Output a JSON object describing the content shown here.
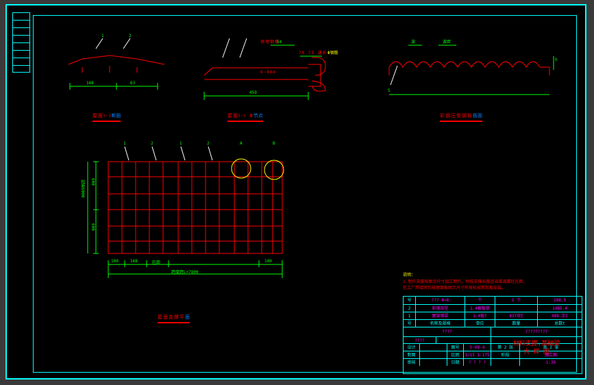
{
  "details": {
    "section_ii": {
      "caption_red": "屋面Ⅰ-Ⅰ",
      "caption_blue": "断面",
      "dim_left": "168",
      "dim_right": "63",
      "lead_1": "1",
      "lead_2": "2"
    },
    "section_b": {
      "caption_red": "屋面Ⅰ-Ⅰ B",
      "caption_blue": "节点",
      "dim_main": "459",
      "note_top": "预埋钢板",
      "note_right_1": "70 79 通长",
      "note_right_2": "Φ钢筋",
      "note_bottom": "6~8mm",
      "dim_small_1": "54"
    },
    "corrugated": {
      "caption_red": "彩钢压型钢板",
      "caption_blue": "板面",
      "pitch_top_l": "波",
      "pitch_top_r": "波距",
      "lead_5": "5",
      "dim_h": "h"
    },
    "plan": {
      "caption_red": "屋面支撑平",
      "caption_blue": "面",
      "lead_1": "1",
      "lead_2": "2",
      "lead_3": "1",
      "lead_4": "2",
      "lead_A": "A",
      "lead_B": "B",
      "dim_total": "跨度跨L=7800",
      "dim_col": "柱距",
      "dim_100": "100",
      "dim_168": "168",
      "dim_60_l": "600",
      "dim_60_r": "600",
      "dim_960": "柱距6000"
    }
  },
  "notes": {
    "hd": "说明：",
    "l1": "1.制作支撑按图示尺寸加工制作，时按支撑长度适当增减螺栓孔距。",
    "l2": "在工厂焊接时均按屋面板图示尺寸所按机械剪剪板安装。"
  },
  "title_block": {
    "materials": [
      [
        "号",
        "名称及规格",
        "单位",
        "数量",
        "总数t"
      ],
      [
        "3",
        "??? 4×8",
        "个",
        "1  个",
        "108.9"
      ],
      [
        "2",
        "彩钢压型",
        "1.4根板草",
        "",
        "1485.4"
      ],
      [
        "1",
        "屋架钢梁",
        "1.4板t",
        "437块t",
        "488.正t"
      ]
    ],
    "company": "????",
    "company_sub": "?????????",
    "project": "????",
    "drawing_title_1": "材料支撑,基础梁",
    "drawing_title_2": "大  样  图",
    "design_row": [
      "设计",
      "",
      "阶段",
      "施工图"
    ],
    "draw_row": [
      "制图",
      "",
      "图号",
      "5-08-4"
    ],
    "check_row": [
      "审核",
      "",
      "比例",
      "1:15 1:175"
    ],
    "app_row": [
      "批准",
      "",
      "日期",
      "1:30"
    ],
    "sheet": "第 2 张",
    "sheets": "共 2 张"
  }
}
